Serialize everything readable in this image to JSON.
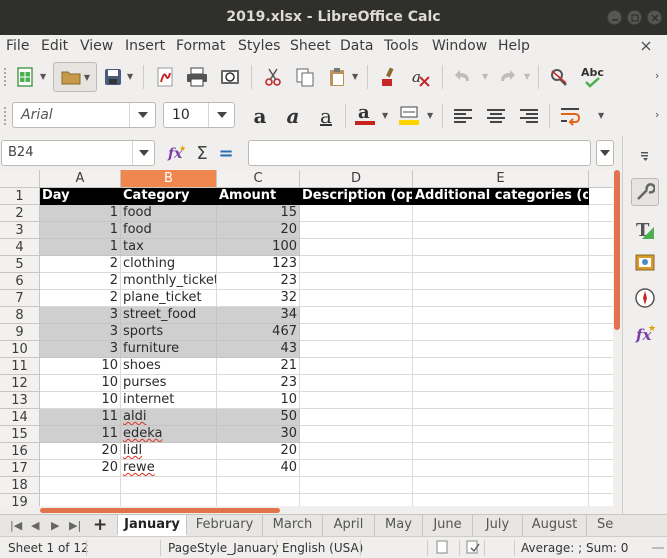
{
  "window": {
    "title": "2019.xlsx - LibreOffice Calc"
  },
  "menu": [
    "File",
    "Edit",
    "View",
    "Insert",
    "Format",
    "Styles",
    "Sheet",
    "Data",
    "Tools",
    "Window",
    "Help"
  ],
  "font": {
    "name": "Arial",
    "size": "10"
  },
  "name_box": "B24",
  "formula_value": "",
  "columns": [
    "A",
    "B",
    "C",
    "D",
    "E"
  ],
  "selected_column": "B",
  "rows": [
    "1",
    "2",
    "3",
    "4",
    "5",
    "6",
    "7",
    "8",
    "9",
    "10",
    "11",
    "12",
    "13",
    "14",
    "15",
    "16",
    "17",
    "18",
    "19"
  ],
  "header_row": [
    "Day",
    "Category",
    "Amount",
    "Description (opt)",
    "Additional categories (opt)"
  ],
  "data_rows": [
    {
      "day": "1",
      "category": "food",
      "amount": "15"
    },
    {
      "day": "1",
      "category": "food",
      "amount": "20"
    },
    {
      "day": "1",
      "category": "tax",
      "amount": "100"
    },
    {
      "day": "2",
      "category": "clothing",
      "amount": "123"
    },
    {
      "day": "2",
      "category": "monthly_ticket",
      "amount": "23"
    },
    {
      "day": "2",
      "category": "plane_ticket",
      "amount": "32"
    },
    {
      "day": "3",
      "category": "street_food",
      "amount": "34"
    },
    {
      "day": "3",
      "category": "sports",
      "amount": "467"
    },
    {
      "day": "3",
      "category": "furniture",
      "amount": "43"
    },
    {
      "day": "10",
      "category": "shoes",
      "amount": "21"
    },
    {
      "day": "10",
      "category": "purses",
      "amount": "23"
    },
    {
      "day": "10",
      "category": "internet",
      "amount": "10"
    },
    {
      "day": "11",
      "category": "aldi",
      "amount": "50"
    },
    {
      "day": "11",
      "category": "edeka",
      "amount": "30"
    },
    {
      "day": "20",
      "category": "lidl",
      "amount": "20"
    },
    {
      "day": "20",
      "category": "rewe",
      "amount": "40"
    }
  ],
  "sheet_tabs": [
    "January",
    "February",
    "March",
    "April",
    "May",
    "June",
    "July",
    "August",
    "Se"
  ],
  "active_sheet": "January",
  "status": {
    "sheet": "Sheet 1 of 12",
    "page_style": "PageStyle_January",
    "language": "English (USA)",
    "sum": "Average: ; Sum: 0"
  },
  "colors": {
    "accent": "#e2734b",
    "selected_col_header": "#f0874f",
    "header_fill": "#000000",
    "gray_band": "#cfcfcf"
  }
}
